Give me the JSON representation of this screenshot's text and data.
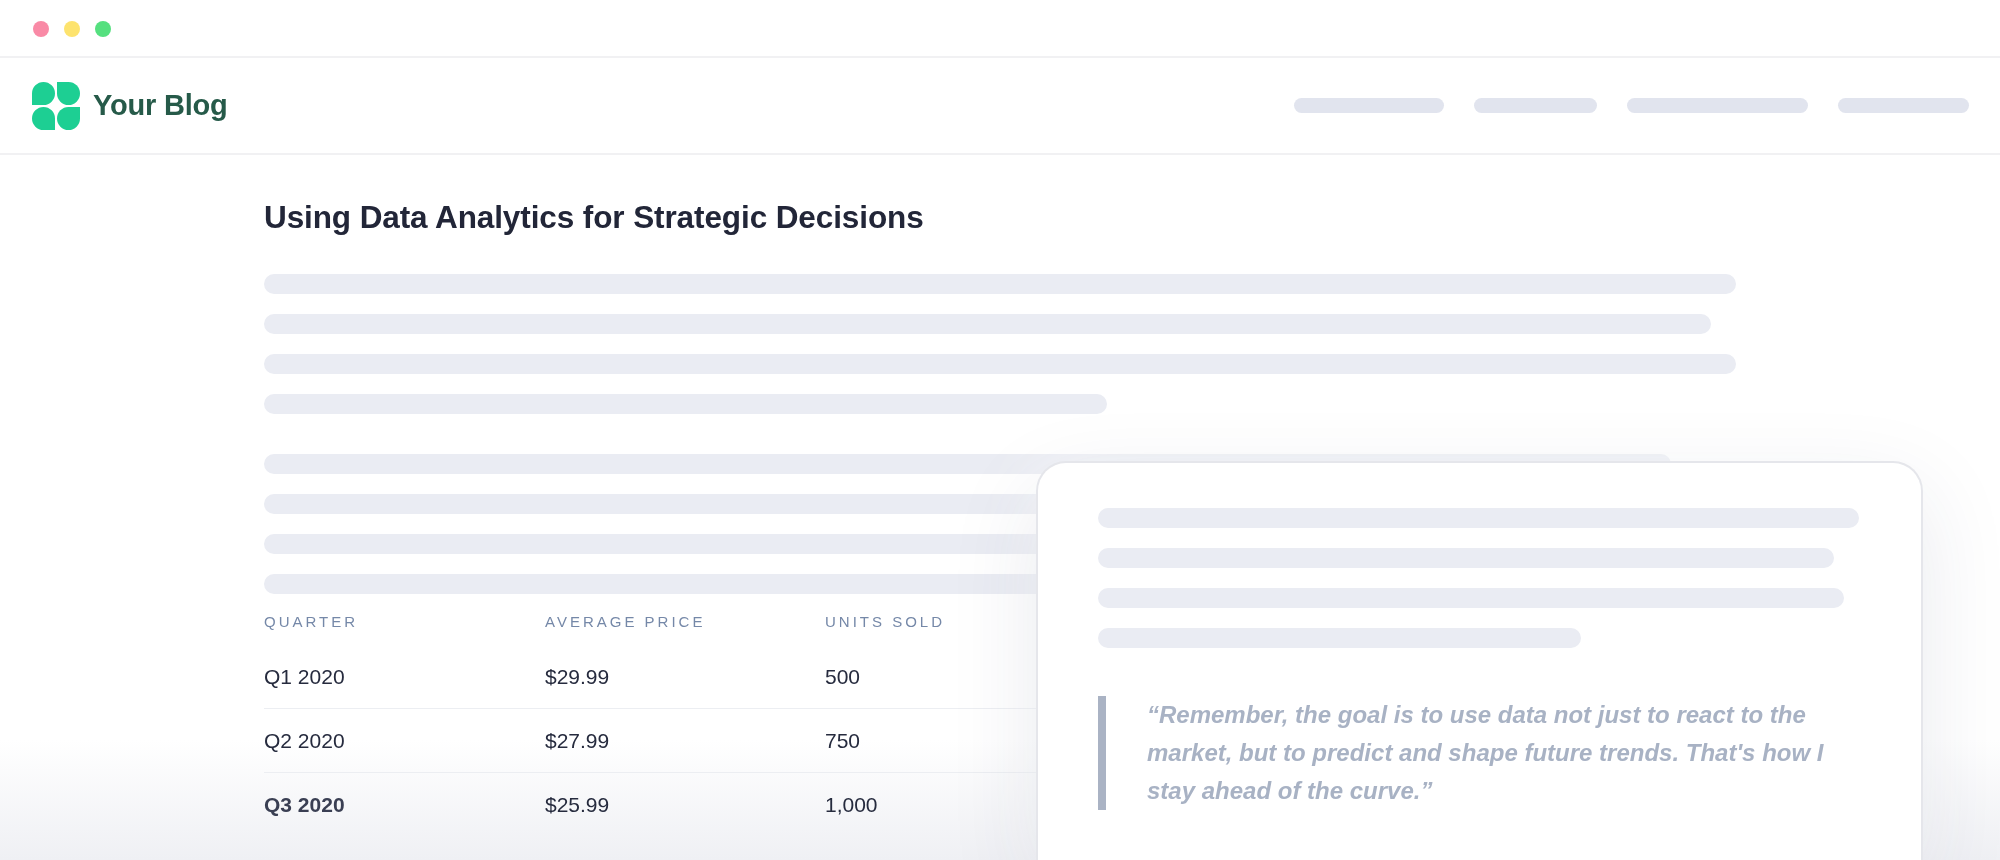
{
  "header": {
    "logo_text": "Your Blog"
  },
  "article": {
    "title": "Using Data Analytics for Strategic Decisions",
    "table": {
      "columns": [
        "QUARTER",
        "AVERAGE PRICE",
        "UNITS SOLD"
      ],
      "rows": [
        {
          "cells": [
            "Q1 2020",
            "$29.99",
            "500"
          ],
          "emphasized": false
        },
        {
          "cells": [
            "Q2 2020",
            "$27.99",
            "750"
          ],
          "emphasized": false
        },
        {
          "cells": [
            "Q3 2020",
            "$25.99",
            "1,000"
          ],
          "emphasized": true
        }
      ]
    }
  },
  "quote_card": {
    "quote": "“Remember, the goal is to use data not just to react to the market, but to predict and shape future trends. That's how I stay ahead of the curve.”"
  }
}
